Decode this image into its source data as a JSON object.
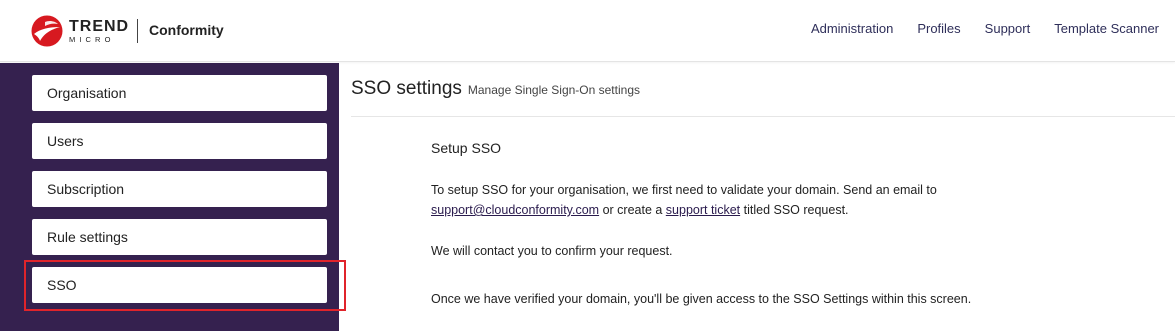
{
  "header": {
    "logo_line1": "TREND",
    "logo_line2": "MICRO",
    "product": "Conformity",
    "nav": [
      "Administration",
      "Profiles",
      "Support",
      "Template Scanner"
    ]
  },
  "sidebar": {
    "items": [
      {
        "label": "Organisation"
      },
      {
        "label": "Users"
      },
      {
        "label": "Subscription"
      },
      {
        "label": "Rule settings"
      },
      {
        "label": "SSO",
        "selected": true
      }
    ]
  },
  "main": {
    "title": "SSO settings",
    "subtitle": "Manage Single Sign-On settings",
    "section_title": "Setup SSO",
    "p1_line1": "To setup SSO for your organisation, we first need to validate your domain. Send an email to",
    "p1_link_email": "support@cloudconformity.com",
    "p1_mid": " or create a ",
    "p1_link_ticket": "support ticket",
    "p1_end": " titled SSO request.",
    "p2": "We will contact you to confirm your request.",
    "p3": "Once we have verified your domain, you'll be given access to the SSO Settings within this screen."
  },
  "colors": {
    "brand_red": "#d71920",
    "sidebar_bg": "#35214f",
    "highlight": "#e0242b",
    "nav_text": "#2f2f5a"
  }
}
